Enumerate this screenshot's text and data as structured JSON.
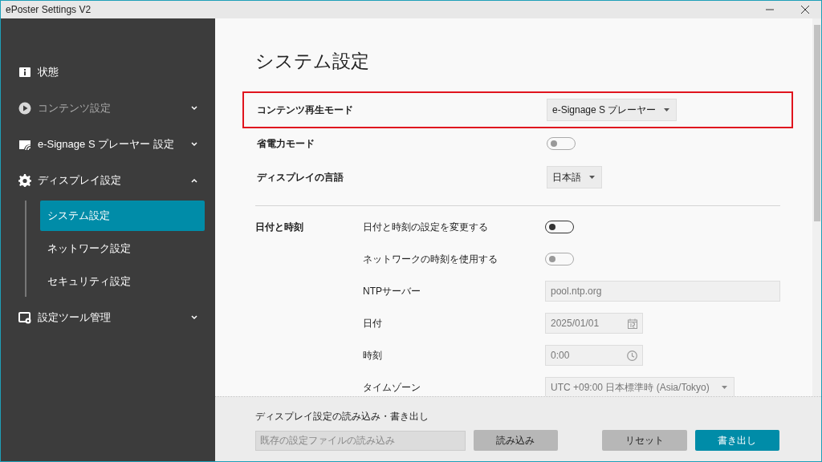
{
  "window": {
    "title": "ePoster Settings V2"
  },
  "sidebar": {
    "items": [
      {
        "label": "状態",
        "disabled": false
      },
      {
        "label": "コンテンツ設定",
        "disabled": true,
        "expanded": false
      },
      {
        "label": "e-Signage S プレーヤー 設定",
        "disabled": false,
        "expanded": false
      },
      {
        "label": "ディスプレイ設定",
        "disabled": false,
        "expanded": true,
        "children": [
          {
            "label": "システム設定",
            "selected": true
          },
          {
            "label": "ネットワーク設定",
            "selected": false
          },
          {
            "label": "セキュリティ設定",
            "selected": false
          }
        ]
      },
      {
        "label": "設定ツール管理",
        "disabled": false,
        "expanded": false
      }
    ]
  },
  "page": {
    "title": "システム設定",
    "settings": [
      {
        "kind": "select",
        "label": "コンテンツ再生モード",
        "value": "e-Signage S プレーヤー",
        "highlighted": true
      },
      {
        "kind": "toggle",
        "label": "省電力モード",
        "on": false,
        "disabled": true,
        "highlighted": false
      },
      {
        "kind": "select",
        "label": "ディスプレイの言語",
        "value": "日本語",
        "highlighted": false
      }
    ],
    "date_time": {
      "title": "日付と時刻",
      "items": [
        {
          "kind": "toggle",
          "label": "日付と時刻の設定を変更する",
          "on": false,
          "disabled": false
        },
        {
          "kind": "toggle",
          "label": "ネットワークの時刻を使用する",
          "on": false,
          "disabled": true
        },
        {
          "kind": "text",
          "label": "NTPサーバー",
          "value": "pool.ntp.org",
          "disabled": true
        },
        {
          "kind": "date",
          "label": "日付",
          "value": "2025/01/01",
          "disabled": true
        },
        {
          "kind": "time",
          "label": "時刻",
          "value": "0:00",
          "disabled": true
        },
        {
          "kind": "select",
          "label": "タイムゾーン",
          "value": "UTC +09:00 日本標準時 (Asia/Tokyo)",
          "disabled": true
        }
      ]
    }
  },
  "footer": {
    "title": "ディスプレイ設定の読み込み・書き出し",
    "file_placeholder": "既存の設定ファイルの読み込み",
    "buttons": [
      {
        "label": "読み込み",
        "kind": "secondary"
      },
      {
        "label": "リセット",
        "kind": "secondary"
      },
      {
        "label": "書き出し",
        "kind": "primary"
      }
    ]
  }
}
